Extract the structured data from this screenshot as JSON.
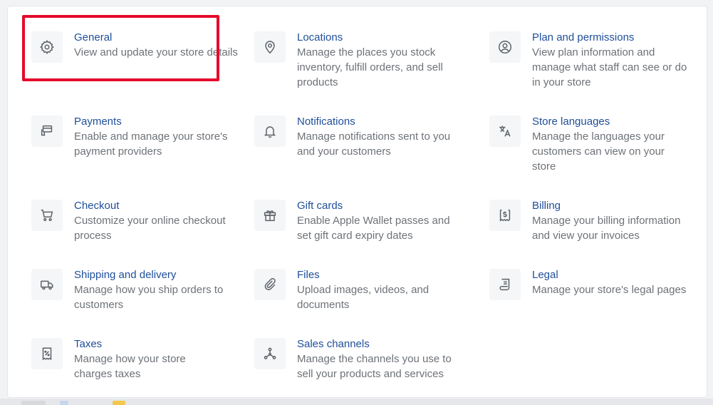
{
  "settings": {
    "items": [
      {
        "title": "General",
        "desc": "View and update your store details",
        "icon": "gear-icon"
      },
      {
        "title": "Locations",
        "desc": "Manage the places you stock inventory, fulfill orders, and sell products",
        "icon": "location-pin-icon"
      },
      {
        "title": "Plan and permissions",
        "desc": "View plan information and manage what staff can see or do in your store",
        "icon": "user-circle-icon"
      },
      {
        "title": "Payments",
        "desc": "Enable and manage your store's payment providers",
        "icon": "payments-icon"
      },
      {
        "title": "Notifications",
        "desc": "Manage notifications sent to you and your customers",
        "icon": "bell-icon"
      },
      {
        "title": "Store languages",
        "desc": "Manage the languages your customers can view on your store",
        "icon": "translate-icon"
      },
      {
        "title": "Checkout",
        "desc": "Customize your online checkout process",
        "icon": "cart-icon"
      },
      {
        "title": "Gift cards",
        "desc": "Enable Apple Wallet passes and set gift card expiry dates",
        "icon": "gift-icon"
      },
      {
        "title": "Billing",
        "desc": "Manage your billing information and view your invoices",
        "icon": "billing-icon"
      },
      {
        "title": "Shipping and delivery",
        "desc": "Manage how you ship orders to customers",
        "icon": "truck-icon"
      },
      {
        "title": "Files",
        "desc": "Upload images, videos, and documents",
        "icon": "paperclip-icon"
      },
      {
        "title": "Legal",
        "desc": "Manage your store's legal pages",
        "icon": "document-icon"
      },
      {
        "title": "Taxes",
        "desc": "Manage how your store charges taxes",
        "icon": "tax-receipt-icon"
      },
      {
        "title": "Sales channels",
        "desc": "Manage the channels you use to sell your products and services",
        "icon": "channels-icon"
      }
    ]
  },
  "colors": {
    "title": "#1f4e9a",
    "description": "#6d7278",
    "highlight": "#e40b2b"
  }
}
